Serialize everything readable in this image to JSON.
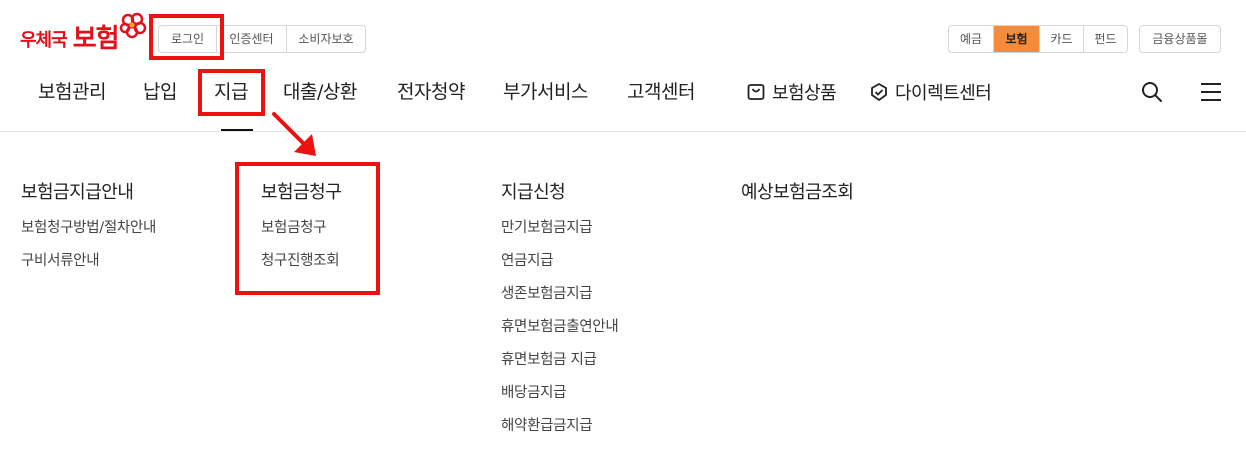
{
  "logo": {
    "small": "우체국",
    "big": "보험"
  },
  "top_links": [
    "로그인",
    "인증센터",
    "소비자보호"
  ],
  "channel_tabs": [
    {
      "label": "예금",
      "active": false
    },
    {
      "label": "보험",
      "active": true
    },
    {
      "label": "카드",
      "active": false
    },
    {
      "label": "펀드",
      "active": false
    }
  ],
  "financial_products_label": "금융상품몰",
  "nav": {
    "items": [
      "보험관리",
      "납입",
      "지급",
      "대출/상환",
      "전자청약",
      "부가서비스",
      "고객센터"
    ],
    "insurance_products": "보험상품",
    "direct_center": "다이렉트센터",
    "active_item": "지급"
  },
  "icons": {
    "bag": "shopping-bag-icon",
    "direct": "shield-check-icon",
    "search": "search-icon",
    "menu": "hamburger-menu-icon"
  },
  "colors": {
    "brand_red": "#e0111c",
    "active_tab": "#f68b3a",
    "annotation_red": "#ee1111"
  },
  "mega_menu": {
    "columns": [
      {
        "title": "보험금지급안내",
        "links": [
          "보험청구방법/절차안내",
          "구비서류안내"
        ]
      },
      {
        "title": "보험금청구",
        "links": [
          "보험금청구",
          "청구진행조회"
        ]
      },
      {
        "title": "지급신청",
        "links": [
          "만기보험금지급",
          "연금지급",
          "생존보험금지급",
          "휴면보험금출연안내",
          "휴면보험금 지급",
          "배당금지급",
          "해약환급금지급"
        ]
      },
      {
        "title": "예상보험금조회",
        "links": []
      }
    ]
  }
}
